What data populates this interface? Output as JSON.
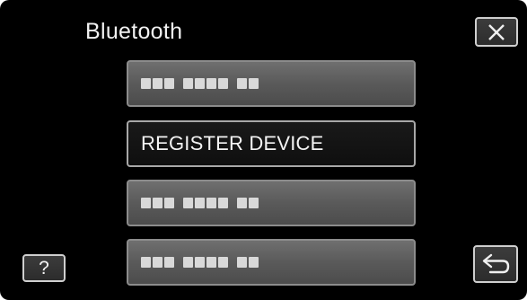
{
  "header": {
    "title": "Bluetooth"
  },
  "menu": {
    "items": [
      {
        "label": "",
        "masked": true
      },
      {
        "label": "REGISTER DEVICE",
        "masked": false
      },
      {
        "label": "",
        "masked": true
      },
      {
        "label": "",
        "masked": true
      }
    ]
  },
  "controls": {
    "close_icon": "close-icon",
    "help_label": "?",
    "back_icon": "return-arrow-icon"
  },
  "colors": {
    "screen_background": "#000000",
    "button_gradient_top": "#6f6f6f",
    "button_gradient_bottom": "#4c4c4c",
    "active_button_background": "#191919",
    "text": "#f4f4f4"
  }
}
